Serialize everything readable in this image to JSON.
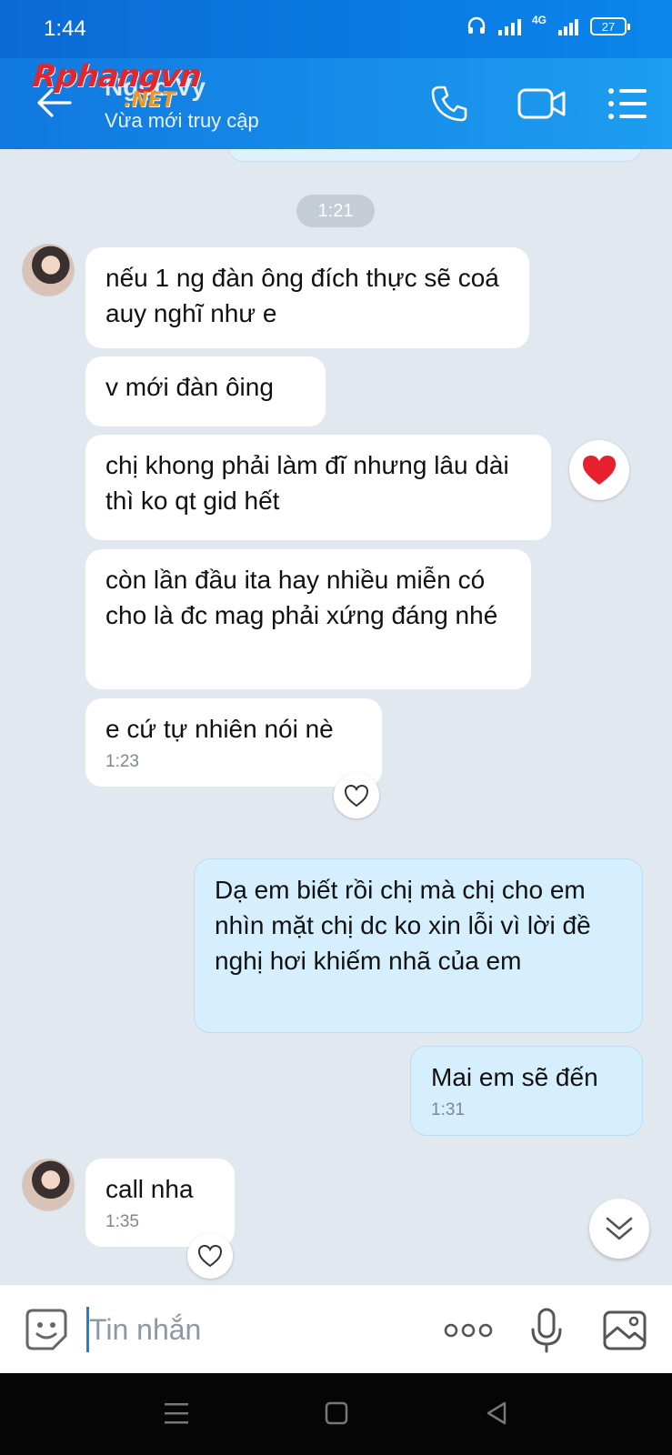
{
  "status_bar": {
    "time": "1:44",
    "network": "4G",
    "battery": "27"
  },
  "header": {
    "contact_name": "Ngọc Vy",
    "contact_status": "Vừa mới truy cập",
    "watermark": "Rphangvn",
    "watermark_suffix": ".NET",
    "icons": [
      "back-arrow-icon",
      "phone-icon",
      "video-call-icon",
      "menu-icon"
    ]
  },
  "chat": {
    "time_divider": "1:21",
    "messages": [
      {
        "side": "in",
        "text": "nếu 1 ng đàn ông đích thực sẽ coá auy nghĩ như e"
      },
      {
        "side": "in",
        "text": "v mới đàn ôing"
      },
      {
        "side": "in",
        "text": "chị khong phải làm đĩ nhưng lâu dài thì ko qt gid hết",
        "reaction": "heart"
      },
      {
        "side": "in",
        "text": "còn lần đầu ita hay nhiều miễn có cho là đc mag phải xứng đáng nhé"
      },
      {
        "side": "in",
        "text": "e cứ tự nhiên nói nè",
        "time": "1:23"
      },
      {
        "side": "out",
        "text": "Dạ em biết rồi chị mà chị cho em nhìn mặt chị dc ko xin lỗi vì lời đề nghị hơi khiếm nhã của em"
      },
      {
        "side": "out",
        "text": "Mai em sẽ đến",
        "time": "1:31"
      },
      {
        "side": "in",
        "text": "call nha",
        "time": "1:35"
      }
    ]
  },
  "input_bar": {
    "placeholder": "Tin nhắn"
  },
  "colors": {
    "header": "#1a8fea",
    "incoming": "#ffffff",
    "outgoing": "#d6efff",
    "background": "#e2e8f0"
  }
}
